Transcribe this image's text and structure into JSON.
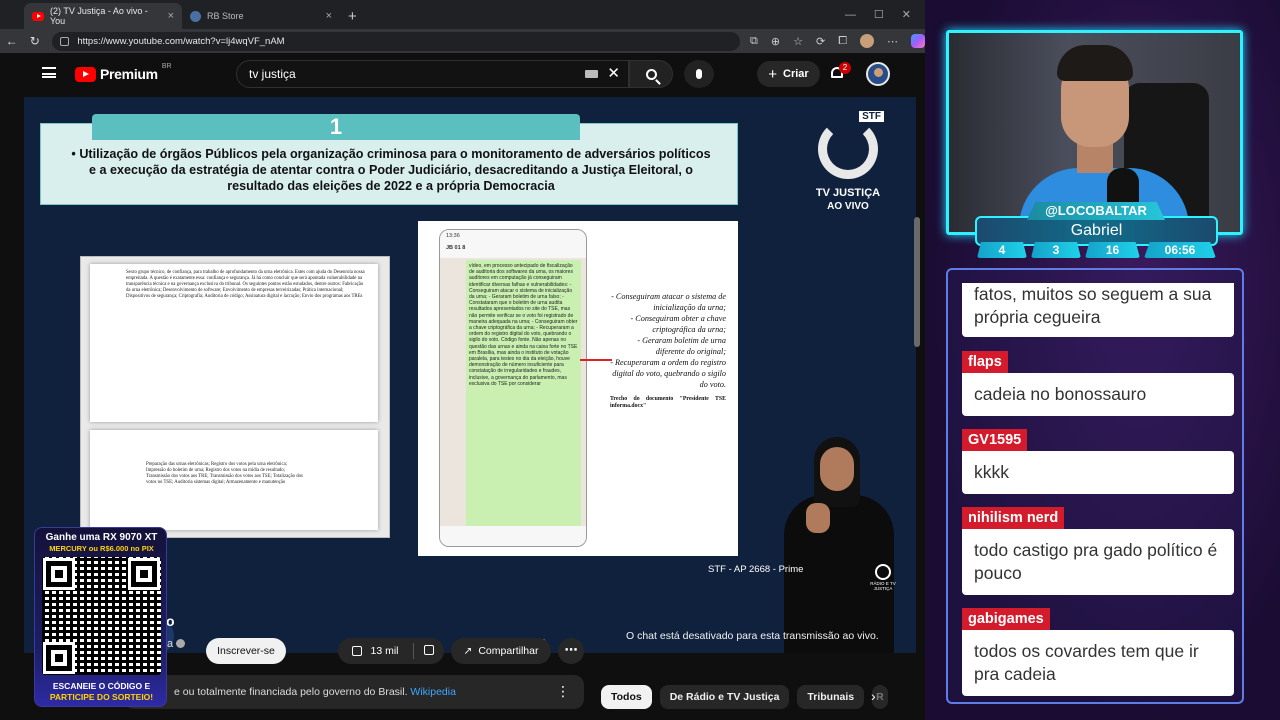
{
  "browser": {
    "tabs": [
      {
        "title": "(2) TV Justiça - Ao vivo - You",
        "active": true
      },
      {
        "title": "RB Store",
        "active": false
      }
    ],
    "url": "https://www.youtube.com/watch?v=lj4wqVF_nAM"
  },
  "youtube": {
    "brand": "Premium",
    "region": "BR",
    "search_value": "tv justiça",
    "create_label": "Criar",
    "notification_count": "2",
    "player": {
      "section_number": "1",
      "banner_text": "• Utilização de órgãos Públicos pela organização criminosa para o monitoramento de adversários políticos e a execução da estratégia de atentar contra o Poder Judiciário, desacreditando a Justiça Eleitoral, o resultado das eleições de 2022 e a própria Democracia",
      "doc_left_text": "Sexto grupo técnico, de confiança, para trabalho de aprofundamento da urna eletrônica. Estes com ajuda do Desenrola nossa empreitada. A questão é exatamente essa: confiança e segurança. Já há como concluir que será apontada vulnerabilidade na transparência técnica e na governança exclusiva do tribunal. Os seguintes pontos estão estudados, dentre outros: Fabricação da urna eletrônica; Desenvolvimento de software; Envolvimento de empresas terceirizadas; Prática internacional; Dispositivos de segurança; Criptografia; Auditoria de código; Assinatura digital e lacração; Envio dos programas aos TREs",
      "doc_left_text_2": "Preparação das urnas eletrônicas; Registro dos votos pela urna eletrônica; Impressão do boletim de urna; Registro dos votos na mídia de resultado; Transmissão dos votos aos TRE; Transmissão dos votos aos TSE; Totalização dos votos no TSE; Auditoria sistemas digital; Armazenamento e manutenção",
      "phone_time": "13:36",
      "phone_contact": "JB 01 8",
      "phone_message": "vídeo, em processo antecipado de fiscalização de auditoria dos softwares da urna, os maiores auditores em computação já conseguiram identificar diversas falhas e vulnerabilidades: - Conseguiram atacar o sistema de inicialização da urna; - Geraram boletim de urna falso; - Constataram que o boletim de urna audita resultados apresentados no site do TSE, mas não permite verificar se o voto foi registrado de maneira adequada na urna; - Conseguiram obter a chave criptográfica da urna; - Recuperaram a ordem do registro digital do voto, quebrando o sigilo do voto. Código fonte. Não apenas no questão das urnas e ainda na caixa forte no TSE em Brasília, mas ainda o instituto de votação paralela, para testes no dia da eleição, houve demonstração de número insuficiente para constatação de irregularidades e fraudes, inclusive, a governança do parlamento, mas exclusiva do TSE por considerar",
      "doc_right_quote": [
        "- Conseguiram atacar o sistema de inicialização da urna;",
        "- Conseguiram obter a chave criptográfica da urna;",
        "- Geraram boletim de urna diferente do original;",
        "- Recuperaram a ordem do registro digital do voto, quebrando o sigilo do voto."
      ],
      "doc_right_caption": "Trecho do documento \"Presidente TSE informa.docx\"",
      "channel_badge": "STF",
      "channel_logo_text": "TV JUSTIÇA",
      "live_label": "AO VIVO",
      "footer_text": "STF - AP 2668 - Prime",
      "radio_label": "RÁDIO E TV JUSTIÇA"
    },
    "video_title": "o",
    "channel_name": "a",
    "subscribe_label": "Inscrever-se",
    "like_count": "13 mil",
    "share_label": "Compartilhar",
    "description": "e ou totalmente financiada pelo governo do Brasil.",
    "description_link": "Wikipedia",
    "chat_disabled": "O chat está desativado para esta transmissão ao vivo.",
    "chips": [
      "Todos",
      "De Rádio e TV Justiça",
      "Tribunais",
      "R"
    ]
  },
  "promo": {
    "line1": "Ganhe uma RX 9070 XT",
    "line2": "MERCURY ou R$6.000 no PIX",
    "footer1": "ESCANEIE O CÓDIGO E",
    "footer2": "PARTICIPE DO SORTEIO!"
  },
  "streamer": {
    "handle": "@LOCOBALTAR",
    "name": "Gabriel",
    "stats": [
      "4",
      "3",
      "16",
      "06:56"
    ],
    "chat": [
      {
        "user": "",
        "text": "fatos, muitos so seguem a sua própria cegueira"
      },
      {
        "user": "flaps",
        "text": "cadeia no bonossauro"
      },
      {
        "user": "GV1595",
        "text": "kkkk"
      },
      {
        "user": "nihilism nerd",
        "text": "todo castigo pra gado político é pouco"
      },
      {
        "user": "gabigames",
        "text": "todos os covardes tem que ir pra cadeia"
      }
    ]
  },
  "colors": {
    "accent_cyan": "#2ef2ff",
    "chat_user_bg": "#d41b2c",
    "yt_red": "#ff0000"
  }
}
